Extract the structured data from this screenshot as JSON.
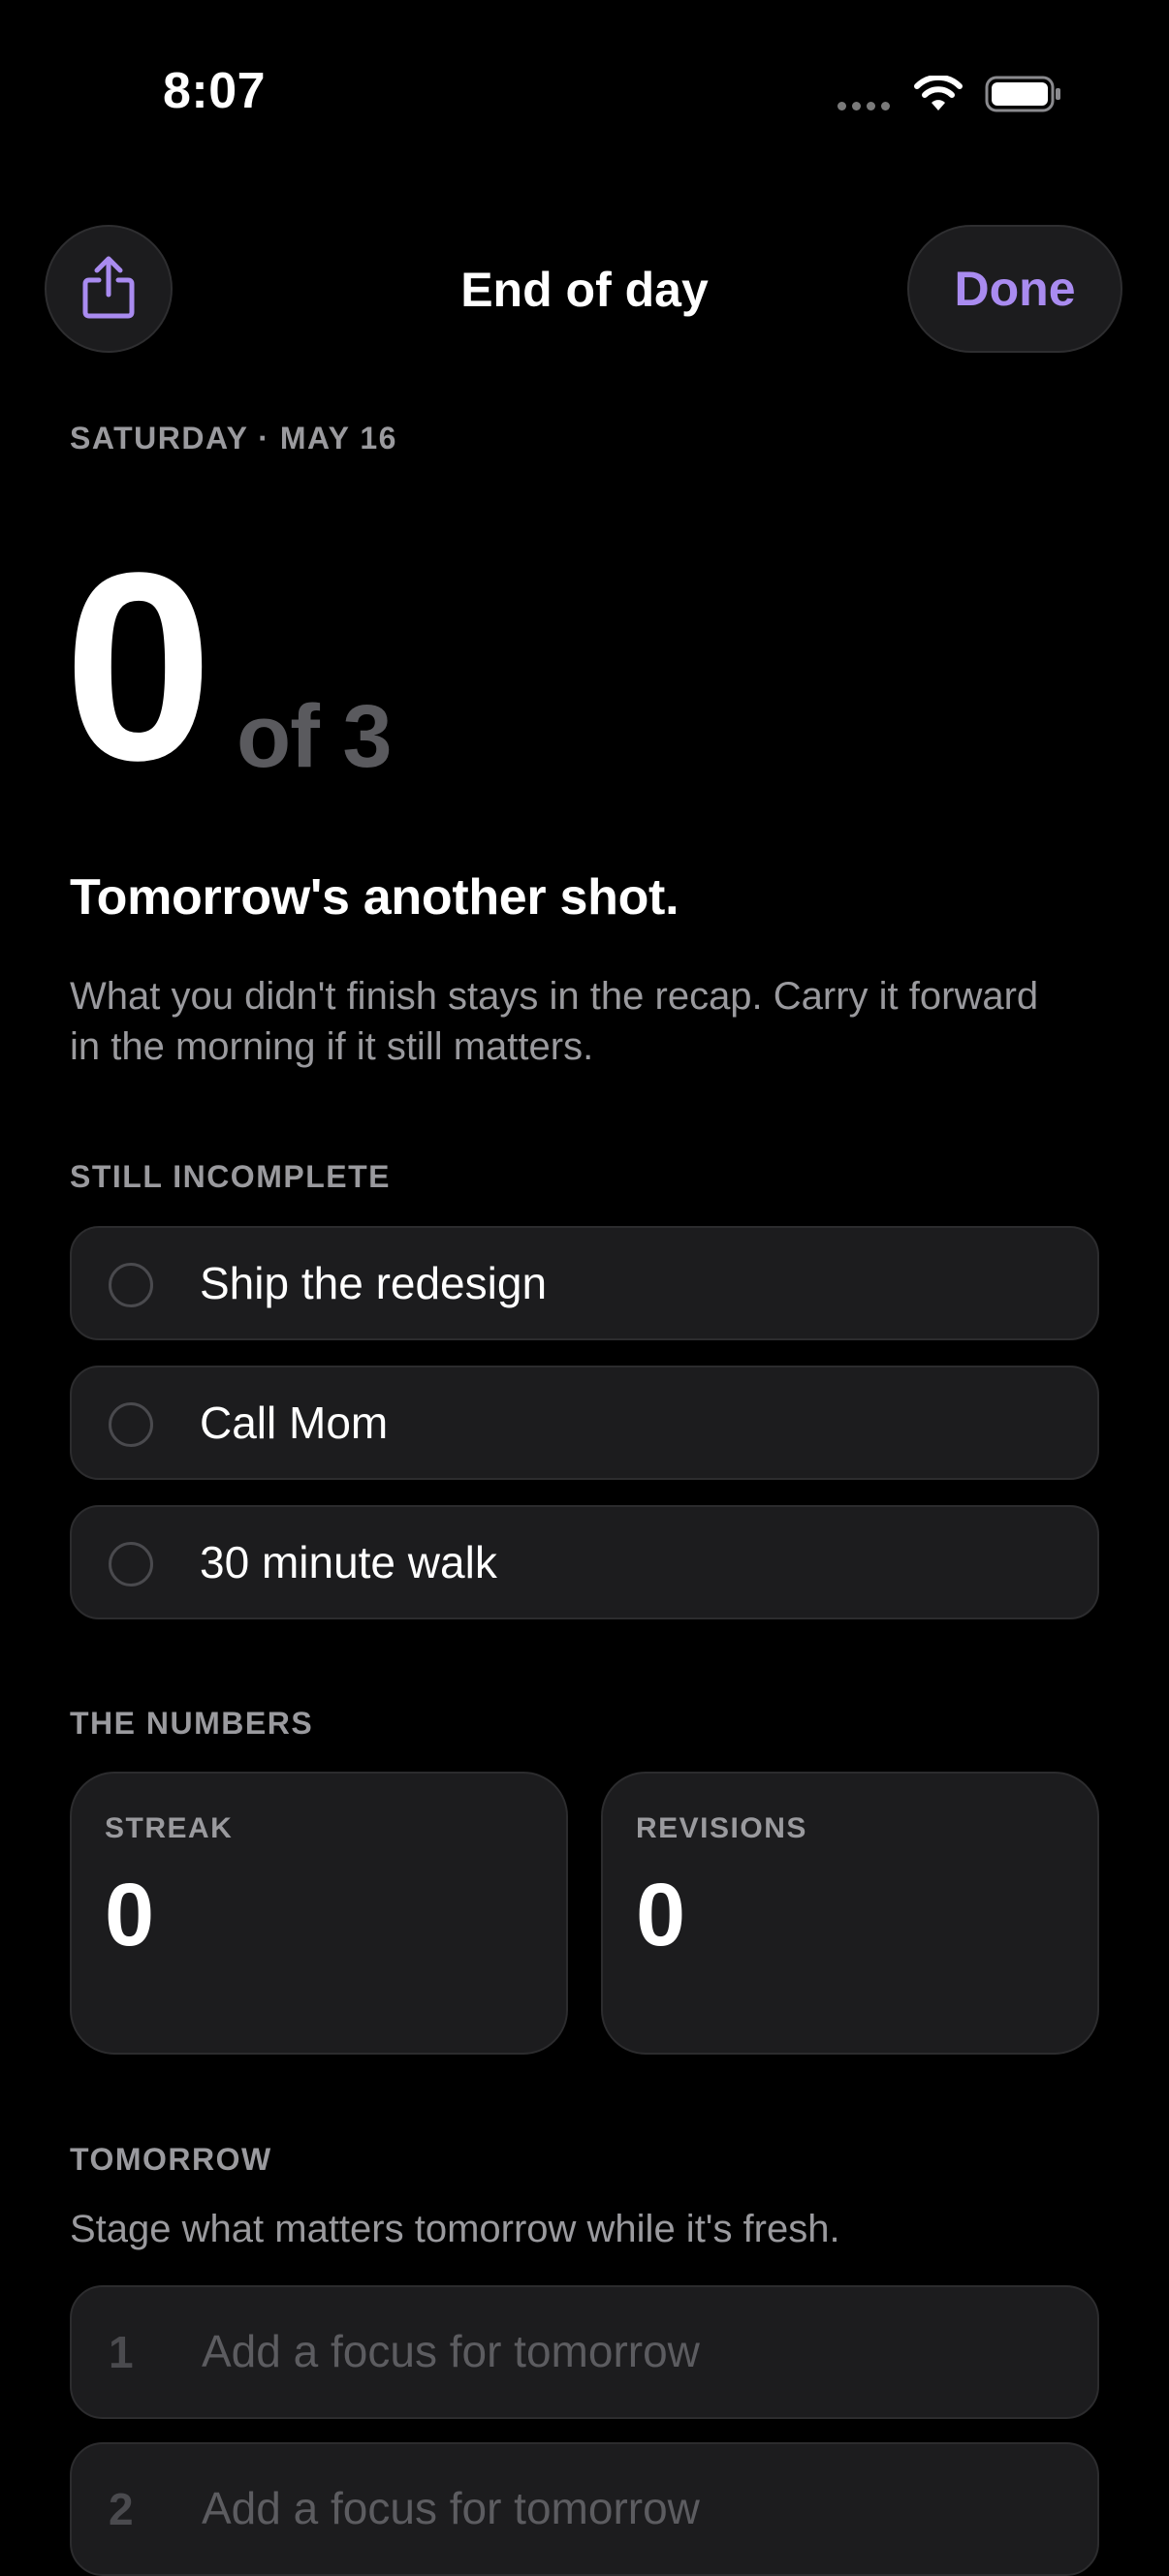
{
  "status_bar": {
    "time": "8:07"
  },
  "nav": {
    "title": "End of day",
    "done_label": "Done",
    "accent_color": "#a98bf0"
  },
  "date_label": "SATURDAY · MAY 16",
  "score": {
    "completed": "0",
    "total_text": "of 3"
  },
  "headline": "Tomorrow's another shot.",
  "subtext": "What you didn't finish stays in the recap. Carry it forward in the morning if it still matters.",
  "incomplete": {
    "label": "STILL INCOMPLETE",
    "tasks": [
      {
        "label": "Ship the redesign"
      },
      {
        "label": "Call Mom"
      },
      {
        "label": "30 minute walk"
      }
    ]
  },
  "numbers": {
    "label": "THE NUMBERS",
    "streak_label": "STREAK",
    "streak_value": "0",
    "revisions_label": "REVISIONS",
    "revisions_value": "0"
  },
  "tomorrow": {
    "label": "TOMORROW",
    "hint": "Stage what matters tomorrow while it's fresh.",
    "focus_rows": [
      {
        "number": "1",
        "placeholder": "Add a focus for tomorrow",
        "value": ""
      },
      {
        "number": "2",
        "placeholder": "Add a focus for tomorrow",
        "value": ""
      }
    ]
  },
  "icons": {
    "share": "share-icon",
    "wifi": "wifi-icon",
    "battery": "battery-icon"
  }
}
